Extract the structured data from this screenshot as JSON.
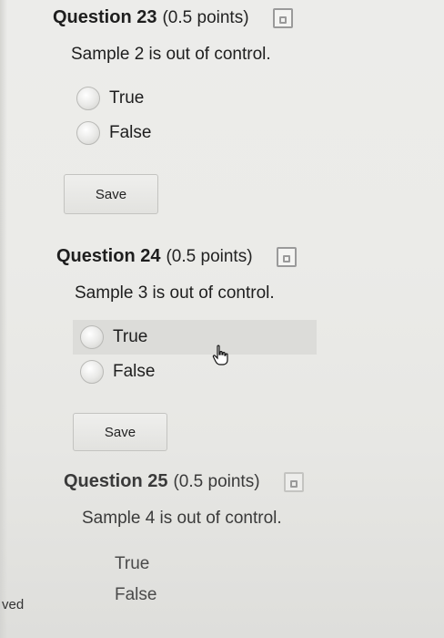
{
  "questions": [
    {
      "title": "Question 23",
      "points": "(0.5 points)",
      "text": "Sample 2 is out of control.",
      "options": [
        "True",
        "False"
      ],
      "save_label": "Save"
    },
    {
      "title": "Question 24",
      "points": "(0.5 points)",
      "text": "Sample 3 is out of control.",
      "options": [
        "True",
        "False"
      ],
      "save_label": "Save"
    },
    {
      "title": "Question 25",
      "points": "(0.5 points)",
      "text": "Sample 4 is out of control.",
      "options": [
        "True",
        "False"
      ]
    }
  ],
  "left_fragment": "ved",
  "icons": {
    "save_state": "floppy-disk-icon",
    "cursor": "hand-pointer-icon"
  }
}
